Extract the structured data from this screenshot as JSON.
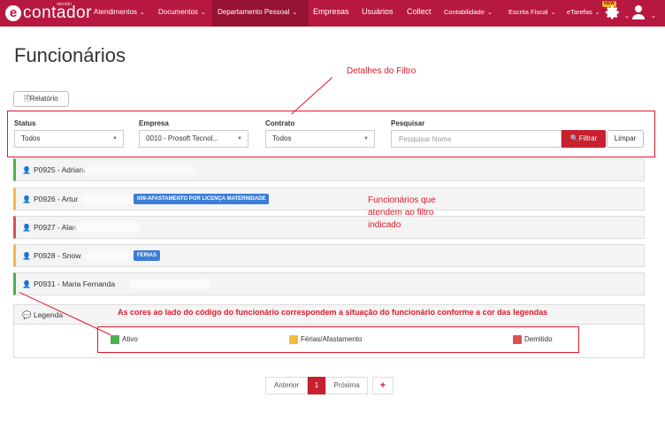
{
  "navbar": {
    "brand_small": "aterado",
    "brand_logo": "e",
    "brand_word": "contador",
    "items": [
      {
        "label": "Atendimentos",
        "dropdown": true
      },
      {
        "label": "Documentos",
        "dropdown": true
      },
      {
        "label": "Departamento Pessoal",
        "dropdown": true,
        "active": true
      },
      {
        "label": "Empresas",
        "dropdown": false
      },
      {
        "label": "Usuários",
        "dropdown": false
      },
      {
        "label": "Collect",
        "dropdown": false
      },
      {
        "label": "Contabilidade",
        "dropdown": true
      },
      {
        "label": "Escrita Fiscal",
        "dropdown": true
      },
      {
        "label": "eTarefas",
        "dropdown": true
      }
    ],
    "caret": "⌄",
    "new_badge": "NEW",
    "icons": [
      "gear-icon",
      "user-icon"
    ],
    "colors": {
      "bar": "#b7183f",
      "active": "#951232"
    }
  },
  "page": {
    "title": "Funcionários",
    "relatorio_button": "Relatório"
  },
  "annotations": {
    "filter_details": "Detalhes do Filtro",
    "employees_line1": "Funcionários que",
    "employees_line2": "atendem ao filtro",
    "employees_line3": "indicado",
    "colors_note": "As cores ao lado do código do funcionário correspondem a situação do funcionário conforme a cor das legendas"
  },
  "filters": {
    "status": {
      "label": "Status",
      "value": "Todos"
    },
    "empresa": {
      "label": "Empresa",
      "value": "0010 - Prosoft Tecnol..."
    },
    "contrato": {
      "label": "Contrato",
      "value": "Todos"
    },
    "pesquisar": {
      "label": "Pesquisar",
      "placeholder": "Pesquisar Nome",
      "value": ""
    },
    "filtrar_button": "Filtrar",
    "limpar_button": "Limpar"
  },
  "employees": [
    {
      "label": "P0925 - Adriana",
      "status": "ativo",
      "color": "#4caf50",
      "tag": ""
    },
    {
      "label": "P0926 - Artur",
      "status": "ferias",
      "color": "#f5b942",
      "tag": "009-AFASTAMENTO POR LICENÇA MATERNIDADE"
    },
    {
      "label": "P0927 - Alana",
      "status": "demitido",
      "color": "#d9534f",
      "tag": ""
    },
    {
      "label": "P0928 - Snow",
      "status": "ferias",
      "color": "#f5b942",
      "tag": "FERIAS"
    },
    {
      "label": "P0931 - Maria Fernanda",
      "status": "ativo",
      "color": "#4caf50",
      "tag": ""
    }
  ],
  "legend": {
    "title": "Legenda",
    "items": [
      {
        "label": "Ativo",
        "color": "#4caf50"
      },
      {
        "label": "Férias/Afastamento",
        "color": "#f5b942"
      },
      {
        "label": "Demitido",
        "color": "#d9534f"
      }
    ]
  },
  "pagination": {
    "previous": "Anterior",
    "current": "1",
    "next": "Próxima",
    "add": "+"
  },
  "icons": {
    "report": "report-icon",
    "search": "search-icon",
    "person": "person-icon",
    "chat": "chat-icon"
  }
}
